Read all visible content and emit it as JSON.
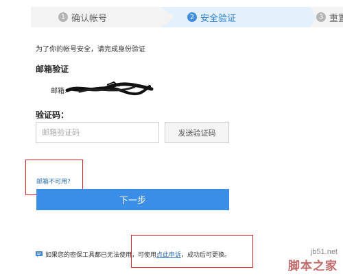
{
  "steps": [
    {
      "num": "1",
      "label": "确认帐号"
    },
    {
      "num": "2",
      "label": "安全验证"
    },
    {
      "num": "3",
      "label": "重置"
    }
  ],
  "intro": "为了你的帐号安全，请完成身份验证",
  "email_section": {
    "title": "邮箱验证",
    "label": "邮箱:"
  },
  "code_section": {
    "title": "验证码：",
    "placeholder": "邮箱验证码",
    "send_button": "发送验证码"
  },
  "unavailable_link": "邮箱不可用?",
  "next_button": "下一步",
  "bottom": {
    "before": "如果您的密保工具都已无法使用，可使用",
    "link": "点此申诉",
    "after": "，成功后可更换。"
  },
  "watermark": {
    "site": "jb51.net",
    "name": "脚本之家"
  },
  "colors": {
    "active_step": "#2a7fd6",
    "primary_button": "#3a8ee6",
    "link": "#2a6fb8",
    "highlight_box": "#e02020"
  }
}
